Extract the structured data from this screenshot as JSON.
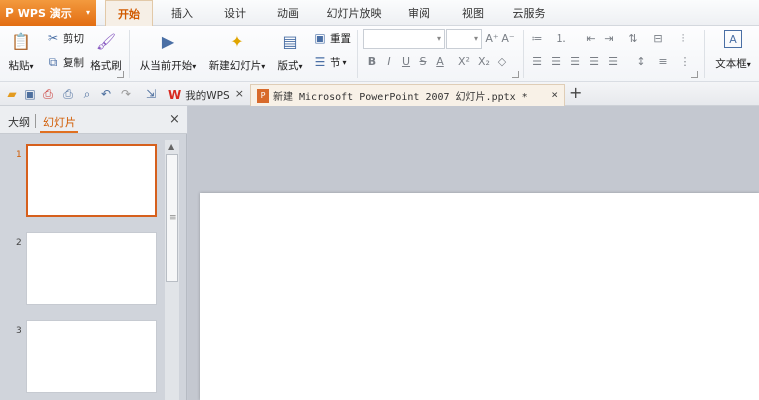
{
  "app": {
    "logo_glyph": "P",
    "title": "WPS 演示",
    "caret": "▾"
  },
  "menu": {
    "tabs": [
      {
        "label": "开始",
        "active": true
      },
      {
        "label": "插入"
      },
      {
        "label": "设计"
      },
      {
        "label": "动画"
      },
      {
        "label": "幻灯片放映"
      },
      {
        "label": "审阅"
      },
      {
        "label": "视图"
      },
      {
        "label": "云服务"
      }
    ]
  },
  "ribbon": {
    "paste": "粘贴",
    "cut": "剪切",
    "copy": "复制",
    "format_painter": "格式刷",
    "play_from_current": "从当前开始",
    "new_slide": "新建幻灯片",
    "layout": "版式",
    "reset": "重置",
    "section": "节",
    "text_box": "文本框",
    "dropdown_caret": "▾"
  },
  "format": {
    "bold": "B",
    "italic": "I",
    "underline": "U",
    "strike": "S",
    "font_color": "A",
    "superscript": "X²",
    "subscript": "X₂",
    "grow": "A⁺",
    "shrink": "A⁻",
    "clear": "◇"
  },
  "doc_tabs": {
    "home_label": "我的WPS",
    "current_label": "新建 Microsoft PowerPoint 2007 幻灯片.pptx *",
    "close": "×",
    "add": "+"
  },
  "left_panel": {
    "tab_outline": "大纲",
    "tab_slides": "幻灯片",
    "close": "×",
    "slides": [
      {
        "number": "1",
        "selected": true
      },
      {
        "number": "2"
      },
      {
        "number": "3"
      }
    ]
  },
  "colors": {
    "accent": "#e26d12",
    "selected_border": "#d6601d",
    "active_tab_text": "#d15a00"
  }
}
